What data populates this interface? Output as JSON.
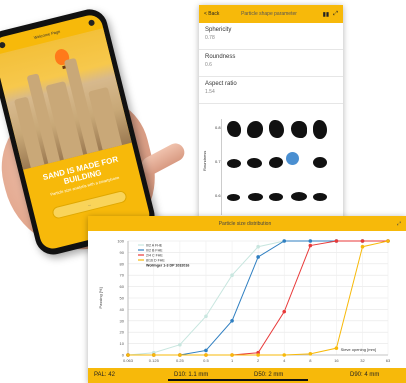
{
  "phone": {
    "title": "Welcome Page",
    "headline": "SAND IS MADE FOR BUILDING",
    "subtitle": "Particle size analysis with a smartphone",
    "button": "..."
  },
  "measure_panel": {
    "back_label": "< Back",
    "title": "Particle shape parameter",
    "metrics": [
      {
        "label": "Sphericity",
        "value": "0.78"
      },
      {
        "label": "Roundness",
        "value": "0.6"
      },
      {
        "label": "Aspect ratio",
        "value": "1.54"
      }
    ],
    "row_labels": [
      "0.8",
      "0.7",
      "0.6"
    ],
    "axis_label": "Roundness"
  },
  "distribution": {
    "title": "Particle size distribution",
    "footer": {
      "left": "PAL: 42",
      "mid1": "D10: 1.1 mm",
      "mid2": "D50: 2 mm",
      "right": "D90: 4 mm"
    },
    "note": "Sieve opening [mm]"
  },
  "chart_data": {
    "type": "line",
    "x": [
      0.063,
      0.125,
      0.25,
      0.5,
      1,
      2,
      4,
      8,
      16,
      32,
      63
    ],
    "x_tick_labels": [
      "0.063",
      "0.125",
      "0.25",
      "0.5",
      "1",
      "2",
      "4",
      "8",
      "16",
      "32",
      "63"
    ],
    "ylabel": "Passing [%]",
    "ylim": [
      0,
      100
    ],
    "y_ticks": [
      0,
      10,
      20,
      30,
      40,
      50,
      60,
      70,
      80,
      90,
      100
    ],
    "grid": true,
    "legend_position": "top-left",
    "series": [
      {
        "name": "0/2 A FHE",
        "color": "#c8e6df",
        "values": [
          0,
          2,
          9,
          34,
          70,
          95,
          100,
          100,
          100,
          100,
          100
        ]
      },
      {
        "name": "0/2 B FHE",
        "color": "#2f7fc1",
        "values": [
          0,
          0,
          0,
          4,
          30,
          86,
          100,
          100,
          100,
          100,
          100
        ]
      },
      {
        "name": "2/4 C FHE",
        "color": "#e83a3a",
        "values": [
          0,
          0,
          0,
          0,
          0,
          2,
          38,
          96,
          100,
          100,
          100
        ]
      },
      {
        "name": "8/16 D FHE",
        "color": "#f7b90a",
        "values": [
          0,
          0,
          0,
          0,
          0,
          0,
          0,
          1,
          6,
          95,
          100
        ]
      }
    ],
    "subtitle_series": "Wollmger 1-3 DP 1032016"
  }
}
